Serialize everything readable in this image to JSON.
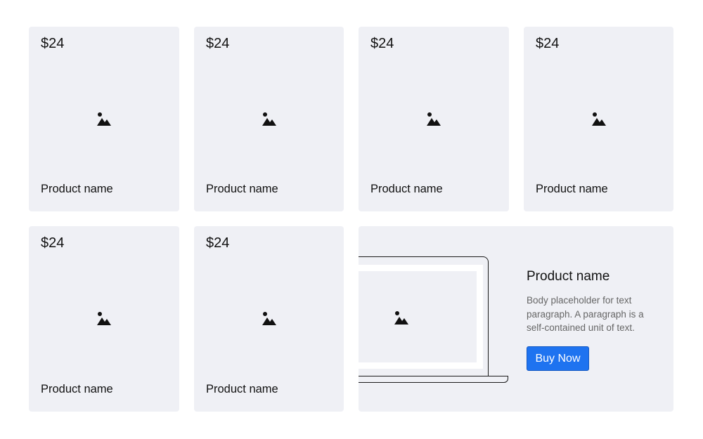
{
  "products": [
    {
      "price": "$24",
      "name": "Product name",
      "image_icon": "image-icon"
    },
    {
      "price": "$24",
      "name": "Product name",
      "image_icon": "image-icon"
    },
    {
      "price": "$24",
      "name": "Product name",
      "image_icon": "image-icon"
    },
    {
      "price": "$24",
      "name": "Product name",
      "image_icon": "image-icon"
    },
    {
      "price": "$24",
      "name": "Product name",
      "image_icon": "image-icon"
    },
    {
      "price": "$24",
      "name": "Product name",
      "image_icon": "image-icon"
    }
  ],
  "featured": {
    "title": "Product name",
    "body": "Body placeholder for text paragraph. A paragraph is a self-contained unit of text.",
    "button_label": "Buy Now",
    "image_icon": "image-icon",
    "device": "laptop-illustration"
  },
  "colors": {
    "card_background": "#eff0f5",
    "accent": "#1e73f0",
    "text": "#111111",
    "muted_text": "#666666"
  }
}
